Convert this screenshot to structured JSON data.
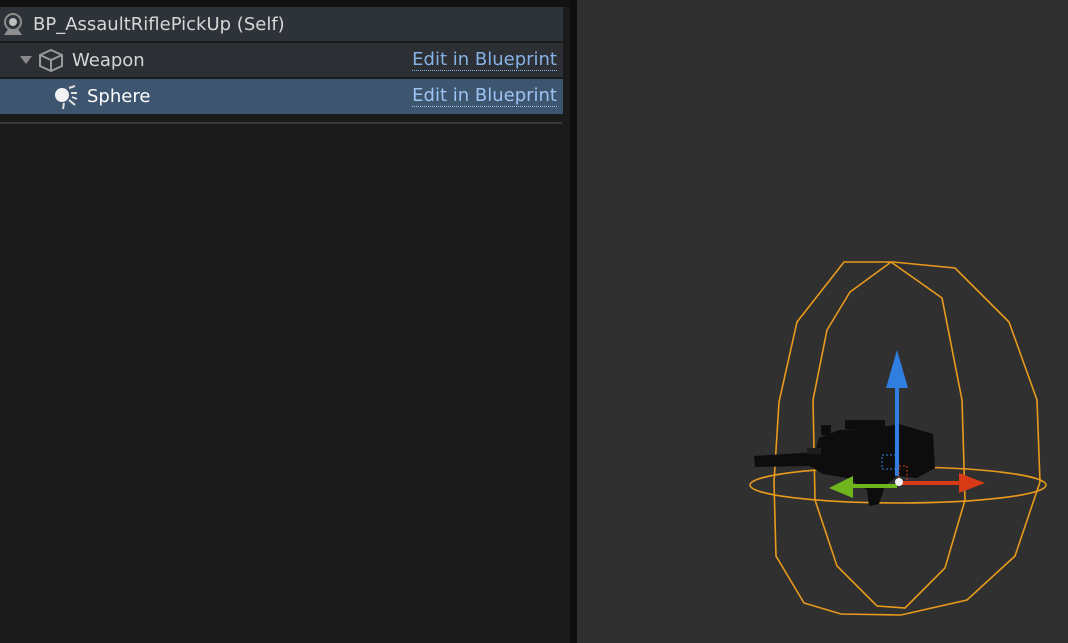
{
  "components": {
    "self_item": {
      "label": "BP_AssaultRiflePickUp (Self)",
      "icon": "actor-icon"
    },
    "items": [
      {
        "label": "Weapon",
        "icon": "static-mesh-cube-icon",
        "expanded": true,
        "link": "Edit in Blueprint",
        "selected": false
      },
      {
        "label": "Sphere",
        "icon": "sphere-collision-icon",
        "link": "Edit in Blueprint",
        "selected": true
      }
    ]
  },
  "viewport": {
    "selected_component": "Sphere",
    "collision_wire_color": "#e89a1c",
    "gizmo_colors": {
      "x": "#d83a16",
      "y": "#6fb51d",
      "z": "#2f7ee0"
    }
  },
  "colors": {
    "panel_bg": "#1b1b1b",
    "row_bg": "#2c2f34",
    "selected_row_bg": "#3e5570",
    "link": "#86b2e6",
    "viewport_bg": "#303030"
  }
}
